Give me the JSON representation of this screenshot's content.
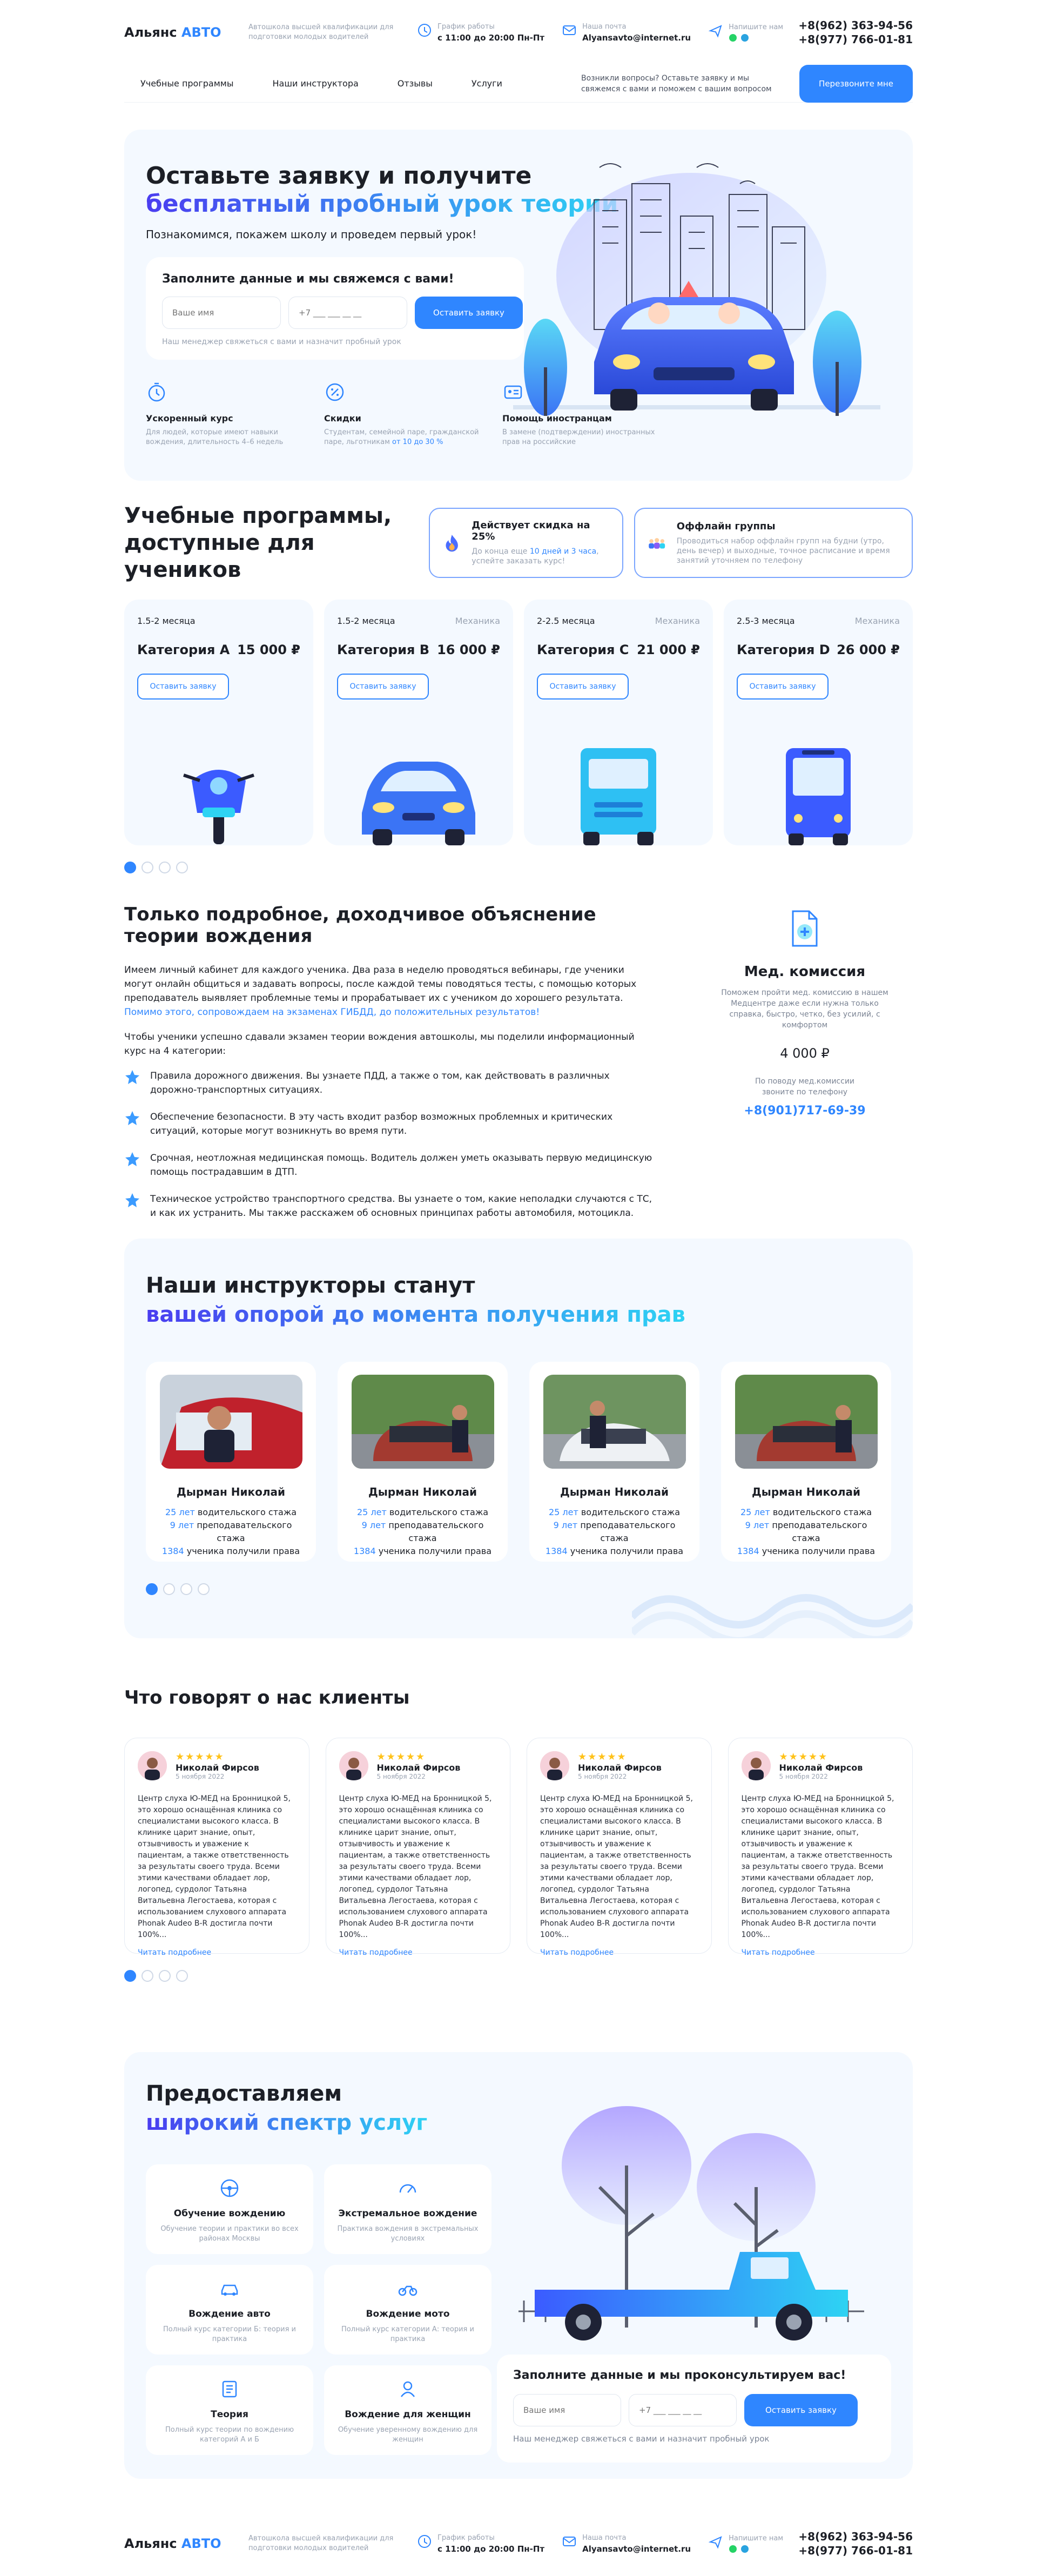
{
  "header": {
    "logo_main": "Альянс",
    "logo_accent": "АВТО",
    "tagline": "Автошкола высшей квалификации для подготовки молодых водителей",
    "schedule_label": "График работы",
    "schedule_value": "с 11:00 до 20:00 Пн-Пт",
    "email_label": "Наша почта",
    "email_value": "Alyansavto@internet.ru",
    "write_label": "Напишите нам",
    "phone1": "+8(962) 363-94-56",
    "phone2": "+8(977) 766-01-81"
  },
  "nav": {
    "items": [
      {
        "label": "Учебные программы"
      },
      {
        "label": "Наши инструктора"
      },
      {
        "label": "Отзывы"
      },
      {
        "label": "Услуги"
      }
    ],
    "question": "Возникли вопросы? Оставьте заявку и мы свяжемся с вами и поможем с вашим вопросом",
    "callback": "Перезвоните мне"
  },
  "hero": {
    "title_line1": "Оставьте заявку и получите",
    "title_line2": "бесплатный пробный урок теории",
    "subtitle": "Познакомимся, покажем школу и проведем первый урок!",
    "form_title": "Заполните данные и мы свяжемся с вами!",
    "name_placeholder": "Ваше имя",
    "phone_placeholder": "+7 ___ ___ __ __",
    "submit": "Оставить заявку",
    "note": "Наш менеджер свяжеться с вами и назначит пробный урок",
    "perks": [
      {
        "title": "Ускоренный курс",
        "text": "Для людей, которые имеют навыки вождения, длительность 4–6 недель"
      },
      {
        "title": "Скидки",
        "text_before": "Студентам, семейной паре, гражданской паре, льготникам ",
        "text_accent": "от 10 до 30 %"
      },
      {
        "title": "Помощь иностранцам",
        "text": "В замене (подтверждении) иностранных прав на российские"
      }
    ]
  },
  "programs": {
    "title": "Учебные программы, доступные для учеников",
    "discount": {
      "title": "Действует скидка на 25%",
      "text_before": "До конца еще ",
      "text_accent": "10 дней и 3 часа",
      "text_after": ", успейте заказать курс!"
    },
    "offline": {
      "title": "Оффлайн группы",
      "text": "Проводиться набор оффлайн групп на будни (утро, день вечер) и выходные, точное расписание и время занятий уточняем по телефону"
    },
    "cards": [
      {
        "duration": "1.5-2 месяца",
        "transmission": "",
        "category": "Категория А",
        "price": "15 000 ₽",
        "button": "Оставить заявку",
        "vehicle": "motorcycle"
      },
      {
        "duration": "1.5-2 месяца",
        "transmission": "Механика",
        "category": "Категория B",
        "price": "16 000 ₽",
        "button": "Оставить заявку",
        "vehicle": "car"
      },
      {
        "duration": "2-2.5 месяца",
        "transmission": "Механика",
        "category": "Категория C",
        "price": "21 000 ₽",
        "button": "Оставить заявку",
        "vehicle": "truck"
      },
      {
        "duration": "2.5-3 месяца",
        "transmission": "Механика",
        "category": "Категория D",
        "price": "26 000 ₽",
        "button": "Оставить заявку",
        "vehicle": "bus"
      }
    ]
  },
  "theory": {
    "title": "Только подробное, доходчивое объяснение теории вождения",
    "p1": "Имеем личный кабинет для каждого ученика. Два раза в неделю проводяться вебинары, где ученики могут онлайн общиться и задавать вопросы, после каждой темы поводяться тесты, с помощью которых преподаватель выявляет проблемные темы и прорабатывает их с учеником до хорошего результата.",
    "p1_accent": "Помимо этого, сопровождаем на экзаменах ГИБДД, до положительных результатов!",
    "p2": "Чтобы ученики успешно сдавали экзамен теории вождения автошколы, мы поделили информационный курс на 4 категории:",
    "bullets": [
      "Правила дорожного движения. Вы узнаете ПДД, а также о том, как действовать в различных дорожно-транспортных ситуациях.",
      "Обеспечение безопасности. В эту часть входит разбор возможных проблемных и критических ситуаций, которые могут возникнуть во время пути.",
      "Срочная, неотложная медицинская помощь. Водитель должен уметь оказывать первую медицинскую помощь пострадавшим в ДТП.",
      "Техническое устройство транспортного средства. Вы узнаете о том, какие неполадки случаются с ТС, и как их устранить. Мы также расскажем об основных принципах работы автомобиля, мотоцикла."
    ],
    "med": {
      "title": "Мед. комиссия",
      "text": "Поможем пройти мед. комиссию в нашем Медцентре даже если нужна только справка, быстро, четко, без усилий, с комфортом",
      "price": "4 000 ₽",
      "contact_label": "По поводу мед.комиссии звоните по телефону",
      "phone": "+8(901)717-69-39"
    }
  },
  "instructors": {
    "title_line1": "Наши инструкторы станут",
    "title_line2": "вашей опорой до момента получения прав",
    "list": [
      {
        "name": "Дырман Николай",
        "years": "25 лет",
        "years_text": " водительского стажа",
        "teach": "9 лет",
        "teach_text": " преподавательского стажа",
        "students": "1384",
        "students_text": " ученика получили права"
      },
      {
        "name": "Дырман Николай",
        "years": "25 лет",
        "years_text": " водительского стажа",
        "teach": "9 лет",
        "teach_text": " преподавательского стажа",
        "students": "1384",
        "students_text": " ученика получили права"
      },
      {
        "name": "Дырман Николай",
        "years": "25 лет",
        "years_text": " водительского стажа",
        "teach": "9 лет",
        "teach_text": " преподавательского стажа",
        "students": "1384",
        "students_text": " ученика получили права"
      },
      {
        "name": "Дырман Николай",
        "years": "25 лет",
        "years_text": " водительского стажа",
        "teach": "9 лет",
        "teach_text": " преподавательского стажа",
        "students": "1384",
        "students_text": " ученика получили права"
      }
    ]
  },
  "reviews": {
    "title": "Что говорят о нас клиенты",
    "list": [
      {
        "stars": "★★★★★",
        "name": "Николай Фирсов",
        "date": "5 ноября 2022",
        "text": "Центр слуха Ю-МЕД на Бронницкой 5, это хорошо оснащённая клиника со специалистами высокого класса. В клинике царит знание, опыт, отзывчивость и уважение к пациентам, а также ответственность за результаты своего труда. Всеми этими качествами обладает лор, логопед, сурдолог Татьяна Витальевна Легостаева, которая с использованием слухового аппарата Phonak Audeo B-R достигла почти 100%...",
        "more": "Читать подробнее"
      },
      {
        "stars": "★★★★★",
        "name": "Николай Фирсов",
        "date": "5 ноября 2022",
        "text": "Центр слуха Ю-МЕД на Бронницкой 5, это хорошо оснащённая клиника со специалистами высокого класса. В клинике царит знание, опыт, отзывчивость и уважение к пациентам, а также ответственность за результаты своего труда. Всеми этими качествами обладает лор, логопед, сурдолог Татьяна Витальевна Легостаева, которая с использованием слухового аппарата Phonak Audeo B-R достигла почти 100%...",
        "more": "Читать подробнее"
      },
      {
        "stars": "★★★★★",
        "name": "Николай Фирсов",
        "date": "5 ноября 2022",
        "text": "Центр слуха Ю-МЕД на Бронницкой 5, это хорошо оснащённая клиника со специалистами высокого класса. В клинике царит знание, опыт, отзывчивость и уважение к пациентам, а также ответственность за результаты своего труда. Всеми этими качествами обладает лор, логопед, сурдолог Татьяна Витальевна Легостаева, которая с использованием слухового аппарата Phonak Audeo B-R достигла почти 100%...",
        "more": "Читать подробнее"
      },
      {
        "stars": "★★★★★",
        "name": "Николай Фирсов",
        "date": "5 ноября 2022",
        "text": "Центр слуха Ю-МЕД на Бронницкой 5, это хорошо оснащённая клиника со специалистами высокого класса. В клинике царит знание, опыт, отзывчивость и уважение к пациентам, а также ответственность за результаты своего труда. Всеми этими качествами обладает лор, логопед, сурдолог Татьяна Витальевна Легостаева, которая с использованием слухового аппарата Phonak Audeo B-R достигла почти 100%...",
        "more": "Читать подробнее"
      }
    ]
  },
  "services": {
    "title_line1": "Предоставляем",
    "title_line2": "широкий спектр услуг",
    "items": [
      {
        "title": "Обучение вождению",
        "text": "Обучение теории и практики во всех районах Москвы",
        "icon": "steering-icon"
      },
      {
        "title": "Экстремальное вождение",
        "text": "Практика вождения в экстремальных условиях",
        "icon": "speed-icon"
      },
      {
        "title": "Вождение авто",
        "text": "Полный курс категории Б: теория и практика",
        "icon": "car-icon"
      },
      {
        "title": "Вождение мото",
        "text": "Полный курс категории А: теория и практика",
        "icon": "moto-icon"
      },
      {
        "title": "Теория",
        "text": "Полный курс теории по вождению категорий А и Б",
        "icon": "book-icon"
      },
      {
        "title": "Вождение для женщин",
        "text": "Обучение уверенному вождению для женщин",
        "icon": "woman-icon"
      }
    ],
    "form_title": "Заполните данные и мы проконсультируем вас!",
    "name_placeholder": "Ваше имя",
    "phone_placeholder": "+7 ___ ___ __ __",
    "submit": "Оставить заявку",
    "note": "Наш менеджер свяжеться с вами и назначит пробный урок"
  },
  "colors": {
    "accent": "#2f86ff",
    "gradient_start": "#4a3df0",
    "gradient_end": "#2ed3f3",
    "panel": "#f4f9ff"
  }
}
